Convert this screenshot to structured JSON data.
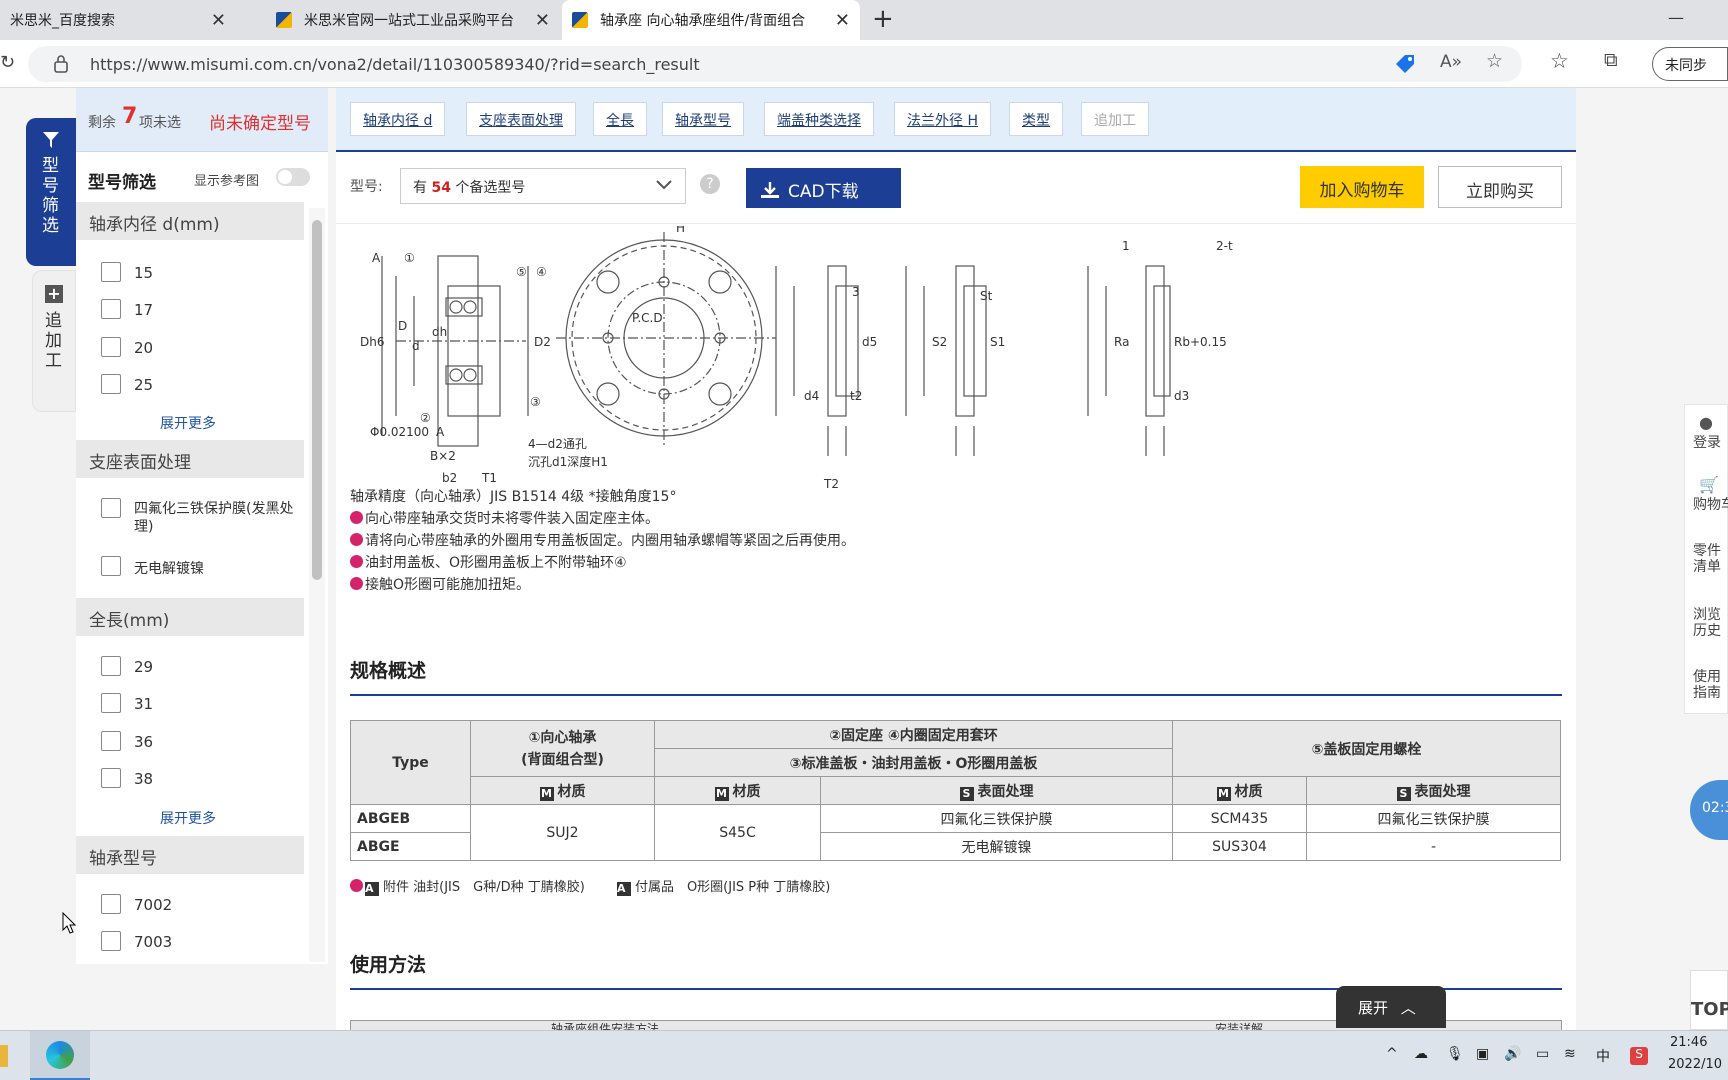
{
  "tabs": [
    {
      "title": "米思米_百度搜索",
      "close": "✕"
    },
    {
      "title": "米思米官网一站式工业品采购平台",
      "close": "✕"
    },
    {
      "title": "轴承座 向心轴承座组件/背面组合",
      "close": "✕"
    }
  ],
  "new_tab": "+",
  "window_min": "—",
  "url": "https://www.misumi.com.cn/vona2/detail/110300589340/?rid=search_result",
  "profile_label": "未同步",
  "side_tabs": {
    "filter": "型号筛选",
    "extra": "追加工"
  },
  "filter": {
    "remaining_prefix": "剩余",
    "remaining_count": "7",
    "remaining_suffix": "项未选",
    "undetermined": "尚未确定型号",
    "title": "型号筛选",
    "show_ref": "显示参考图",
    "more_label": "展开更多",
    "sections": [
      {
        "title": "轴承内径 d(mm)",
        "options": [
          "15",
          "17",
          "20",
          "25"
        ]
      },
      {
        "title": "支座表面处理",
        "options": [
          "四氟化三铁保护膜(发黑处理)",
          "无电解镀镍"
        ]
      },
      {
        "title": "全長(mm)",
        "options": [
          "29",
          "31",
          "36",
          "38"
        ]
      },
      {
        "title": "轴承型号",
        "options": [
          "7002",
          "7003"
        ]
      }
    ]
  },
  "breadcrumbs": [
    "轴承内径 d",
    "支座表面处理",
    "全長",
    "轴承型号",
    "端盖种类选择",
    "法兰外径 H",
    "类型",
    "追加工"
  ],
  "toolbar": {
    "model_label": "型号:",
    "select_prefix": "有",
    "select_count": "54",
    "select_suffix": "个备选型号",
    "help": "?",
    "cad": "CAD下载",
    "cart": "加入购物车",
    "buy": "立即购买"
  },
  "drawing": {
    "labels": [
      "A",
      "①",
      "⑤",
      "④",
      "③",
      "②",
      "D",
      "d",
      "dh",
      "D2",
      "P.C.D",
      "B×2",
      "b2",
      "T1",
      "T2",
      "4—d2通孔",
      "沉孔d1深度H1",
      "Φ0.02100",
      "A",
      "3",
      "d5",
      "d4",
      "St",
      "S2",
      "S1",
      "Ra",
      "Rb+0.15",
      "t2",
      "d3",
      "Dh6",
      "2-t",
      "1",
      "H"
    ]
  },
  "notes": [
    "轴承精度（向心轴承）JIS B1514 4级 *接触角度15°",
    "向心带座轴承交货时未将零件装入固定座主体。",
    "请将向心带座轴承的外圈用专用盖板固定。内圈用轴承螺帽等紧固之后再使用。",
    "油封用盖板、O形圈用盖板上不附带轴环④",
    "接触O形圈可能施加扭矩。"
  ],
  "spec": {
    "title": "规格概述",
    "h_type": "Type",
    "h_bearing_1": "①向心轴承",
    "h_bearing_2": "(背面组合型)",
    "h_seat": "②固定座 ④内圈固定用套环",
    "h_cover": "③标准盖板・油封用盖板・O形圈用盖板",
    "h_bolt": "⑤盖板固定用螺栓",
    "m_mark": "M",
    "s_mark": "S",
    "material": "材质",
    "surface": "表面处理",
    "rows": [
      {
        "type": "ABGEB",
        "bearing": "SUJ2",
        "seat": "S45C",
        "surface": "四氟化三铁保护膜",
        "bolt": "SCM435",
        "bolt_surface": "四氟化三铁保护膜"
      },
      {
        "type": "ABGE",
        "surface": "无电解镀镍",
        "bolt": "SUS304",
        "bolt_surface": "-"
      }
    ],
    "footnote_a": "A",
    "footnote_1": "附件 油封(JIS　G种/D种 丁腈橡胶)",
    "footnote_2": "付属品　O形圈(JIS P种 丁腈橡胶)"
  },
  "usage_title": "使用方法",
  "usage_table_left": "轴承座组件安装方法",
  "usage_table_right": "安装详解",
  "right_sidebar": [
    "登录",
    "购物车",
    "零件清单",
    "浏览历史",
    "使用指南"
  ],
  "timer": "02:3",
  "expand_label": "展开",
  "top_label": "TOP",
  "taskbar": {
    "time": "21:46",
    "date": "2022/10",
    "ime": "中"
  }
}
